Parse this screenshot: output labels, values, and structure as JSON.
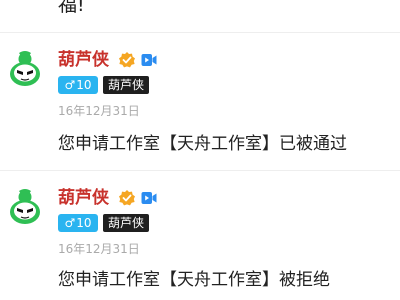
{
  "top_fragment": "福!",
  "messages": [
    {
      "username": "葫芦侠",
      "gender_symbol": "♂",
      "level": "10",
      "title_badge": "葫芦侠",
      "date": "16年12月31日",
      "content": "您申请工作室【天舟工作室】已被通过"
    },
    {
      "username": "葫芦侠",
      "gender_symbol": "♂",
      "level": "10",
      "title_badge": "葫芦侠",
      "date": "16年12月31日",
      "content": "您申请工作室【天舟工作室】被拒绝"
    }
  ],
  "colors": {
    "username": "#c8322c",
    "gender_badge": "#2ab4f0",
    "title_badge": "#1f1f1f",
    "verified": "#f5a623",
    "video_icon": "#2b8cf0",
    "avatar_green": "#2fbf54"
  }
}
